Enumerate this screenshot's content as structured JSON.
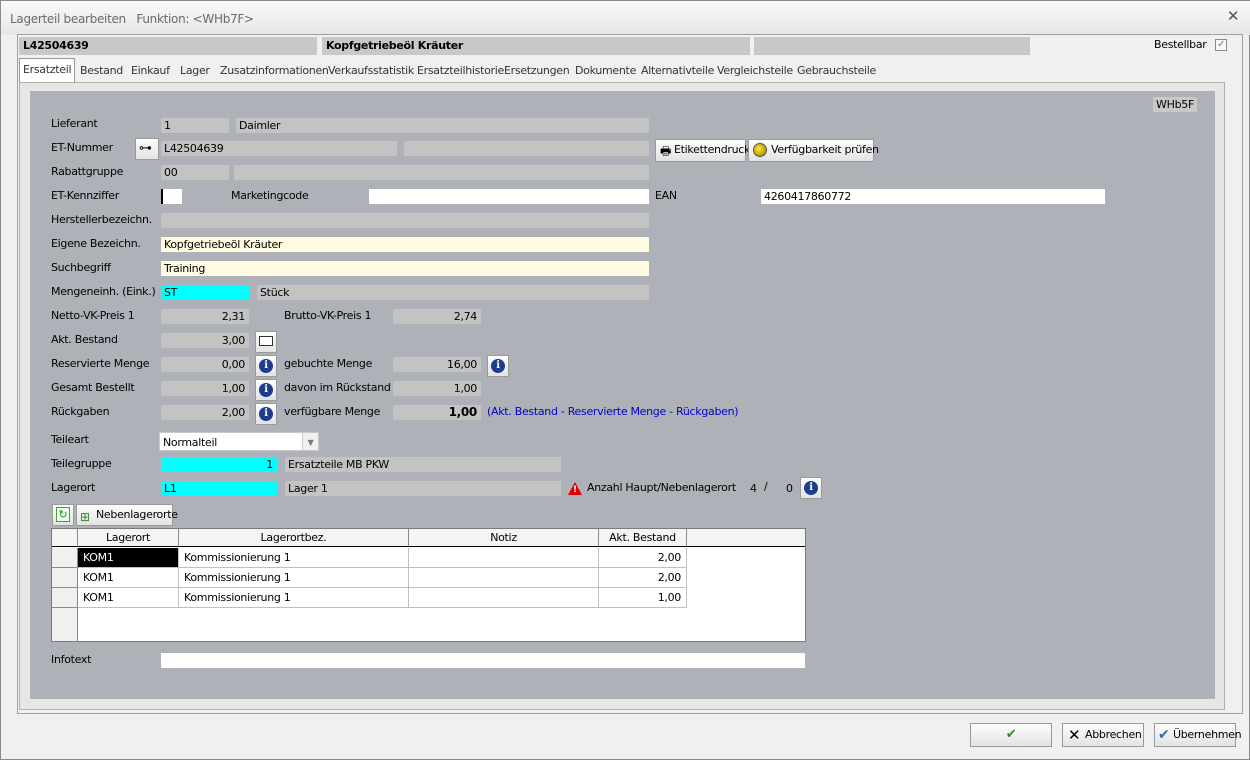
{
  "window": {
    "title": "Lagerteil bearbeiten",
    "function_label": "Funktion: <WHb7F>"
  },
  "header": {
    "part_number": "L42504639",
    "part_name": "Kopfgetriebeöl Kräuter",
    "orderable_label": "Bestellbar",
    "orderable_checked": true
  },
  "tabs": [
    {
      "label": "Ersatzteil",
      "active": true
    },
    {
      "label": "Bestand"
    },
    {
      "label": "Einkauf"
    },
    {
      "label": "Lager"
    },
    {
      "label": "Zusatzinformationen"
    },
    {
      "label": "Verkaufsstatistik"
    },
    {
      "label": "Ersatzteilhistorie"
    },
    {
      "label": "Ersetzungen"
    },
    {
      "label": "Dokumente"
    },
    {
      "label": "Alternativteile"
    },
    {
      "label": "Vergleichsteile"
    },
    {
      "label": "Gebrauchsteile"
    }
  ],
  "form": {
    "corner_code": "WHb5F",
    "lieferant_label": "Lieferant",
    "lieferant_nr": "1",
    "lieferant_name": "Daimler",
    "et_nummer_label": "ET-Nummer",
    "et_nummer": "L42504639",
    "et_nummer_extra": "",
    "etikettendruck": "Etikettendruck",
    "verfuegbarkeit": "Verfügbarkeit prüfen",
    "rabattgruppe_label": "Rabattgruppe",
    "rabattgruppe": "00",
    "rabattgruppe_text": "",
    "et_kennziffer_label": "ET-Kennziffer",
    "et_kennziffer": "",
    "marketingcode_label": "Marketingcode",
    "marketingcode": "",
    "ean_label": "EAN",
    "ean": "4260417860772",
    "herstellerbez_label": "Herstellerbezeichn.",
    "herstellerbez": "",
    "eigene_bez_label": "Eigene Bezeichn.",
    "eigene_bez": "Kopfgetriebeöl Kräuter",
    "suchbegriff_label": "Suchbegriff",
    "suchbegriff": "Training",
    "mengeneinh_label": "Mengeneinh. (Eink.)",
    "mengeneinh": "ST",
    "mengeneinh_text": "Stück",
    "netto_label": "Netto-VK-Preis 1",
    "netto": "2,31",
    "brutto_label": "Brutto-VK-Preis 1",
    "brutto": "2,74",
    "akt_bestand_label": "Akt. Bestand",
    "akt_bestand": "3,00",
    "reserviert_label": "Reservierte Menge",
    "reserviert": "0,00",
    "gebucht_label": "gebuchte Menge",
    "gebucht": "16,00",
    "gesamt_bestellt_label": "Gesamt Bestellt",
    "gesamt_bestellt": "1,00",
    "rueckstand_label": "davon im Rückstand",
    "rueckstand": "1,00",
    "rueckgaben_label": "Rückgaben",
    "rueckgaben": "2,00",
    "verfuegbar_label": "verfügbare Menge",
    "verfuegbar": "1,00",
    "verfuegbar_hint": "(Akt. Bestand - Reservierte Menge - Rückgaben)",
    "teileart_label": "Teileart",
    "teileart": "Normalteil",
    "teilegruppe_label": "Teilegruppe",
    "teilegruppe": "1",
    "teilegruppe_text": "Ersatzteile MB PKW",
    "lagerort_label": "Lagerort",
    "lagerort": "L1",
    "lagerort_text": "Lager 1",
    "anzahl_label": "Anzahl Haupt/Nebenlagerort",
    "anzahl_haupt": "4",
    "anzahl_sep": "/",
    "anzahl_neben": "0",
    "nebenlagerorte_btn": "Nebenlagerorte",
    "infotext_label": "Infotext",
    "infotext": ""
  },
  "grid": {
    "columns": [
      "Lagerort",
      "Lagerortbez.",
      "Notiz",
      "Akt. Bestand"
    ],
    "rows": [
      {
        "lagerort": "KOM1",
        "bez": "Kommissionierung 1",
        "notiz": "",
        "bestand": "2,00"
      },
      {
        "lagerort": "KOM1",
        "bez": "Kommissionierung 1",
        "notiz": "",
        "bestand": "2,00"
      },
      {
        "lagerort": "KOM1",
        "bez": "Kommissionierung 1",
        "notiz": "",
        "bestand": "1,00"
      }
    ]
  },
  "footer": {
    "ok_label": "",
    "cancel_label": "Abbrechen",
    "apply_label": "Übernehmen"
  },
  "colors": {
    "panel": "#aeb2b8",
    "field": "#c3c3c3",
    "cyan": "#00ffff",
    "yellow": "#fffbe0",
    "info_blue": "#1d3d8f",
    "hint_blue": "#0000cc"
  }
}
